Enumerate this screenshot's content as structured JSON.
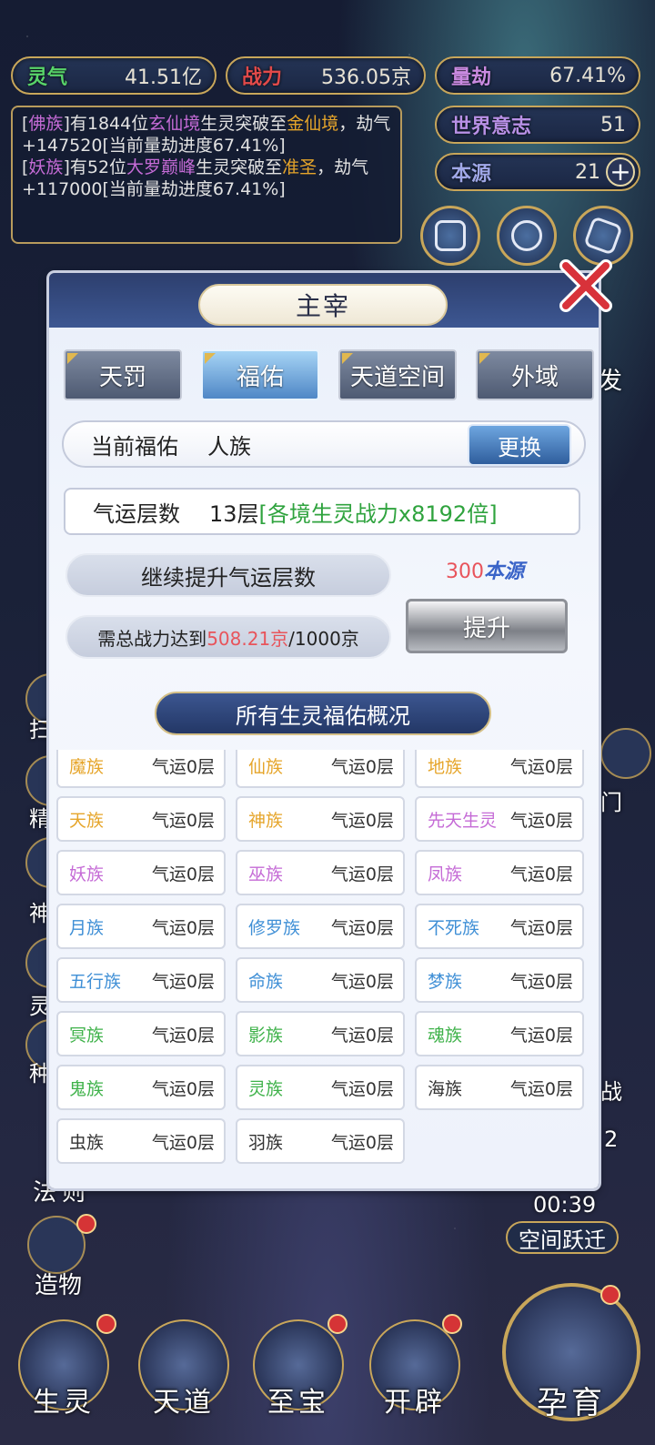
{
  "top_stats": {
    "lingqi": {
      "label": "灵气",
      "value": "41.51亿",
      "color": "#58d46a"
    },
    "zhanli": {
      "label": "战力",
      "value": "536.05京",
      "color": "#e14a4a"
    },
    "liangjie": {
      "label": "量劫",
      "value": "67.41%",
      "color": "#c98ae0"
    },
    "shijie": {
      "label": "世界意志",
      "value": "51",
      "color": "#b890e6"
    },
    "benyuan": {
      "label": "本源",
      "value": "21",
      "color": "#a0a8e8"
    }
  },
  "log": [
    {
      "bracket_open": "[",
      "race": "佛族",
      "race_color": "#c56bd6",
      "bracket_close": "]",
      "t1": "有1844位",
      "realm": "玄仙境",
      "realm_color": "#c56bd6",
      "t2": "生灵突破至",
      "target": "金仙境",
      "target_color": "#e6a52a",
      "t3": "，劫气+147520[当前量劫进度67.41%]"
    },
    {
      "bracket_open": "[",
      "race": "妖族",
      "race_color": "#c56bd6",
      "bracket_close": "]",
      "t1": "有52位",
      "realm": "大罗巅峰",
      "realm_color": "#c56bd6",
      "t2": "生灵突破至",
      "target": "准圣",
      "target_color": "#e6a52a",
      "t3": "，劫气+117000[当前量劫进度67.41%]"
    }
  ],
  "panel": {
    "title": "主宰",
    "tabs": [
      "天罚",
      "福佑",
      "天道空间",
      "外域",
      "发"
    ],
    "current_label": "当前福佑",
    "current_value": "人族",
    "swap_label": "更换",
    "luck_label": "气运层数",
    "luck_value": "13层",
    "luck_bonus": "[各境生灵战力x8192倍]",
    "continue_label": "继续提升气运层数",
    "req_prefix": "需总战力达到",
    "req_current": "508.21京",
    "req_target": "/1000京",
    "cost_num": "300",
    "cost_unit": "本源",
    "upgrade_label": "提升",
    "overview_label": "所有生灵福佑概况"
  },
  "races": [
    {
      "name": "魔族",
      "level": "气运0层",
      "color": "#e6a52a"
    },
    {
      "name": "仙族",
      "level": "气运0层",
      "color": "#e6a52a"
    },
    {
      "name": "地族",
      "level": "气运0层",
      "color": "#e6a52a"
    },
    {
      "name": "天族",
      "level": "气运0层",
      "color": "#e6a52a"
    },
    {
      "name": "神族",
      "level": "气运0层",
      "color": "#e6a52a"
    },
    {
      "name": "先天生灵",
      "level": "气运0层",
      "color": "#c56bd6"
    },
    {
      "name": "妖族",
      "level": "气运0层",
      "color": "#c56bd6"
    },
    {
      "name": "巫族",
      "level": "气运0层",
      "color": "#c56bd6"
    },
    {
      "name": "凤族",
      "level": "气运0层",
      "color": "#c56bd6"
    },
    {
      "name": "月族",
      "level": "气运0层",
      "color": "#3f8fd6"
    },
    {
      "name": "修罗族",
      "level": "气运0层",
      "color": "#3f8fd6"
    },
    {
      "name": "不死族",
      "level": "气运0层",
      "color": "#3f8fd6"
    },
    {
      "name": "五行族",
      "level": "气运0层",
      "color": "#3f8fd6"
    },
    {
      "name": "命族",
      "level": "气运0层",
      "color": "#3f8fd6"
    },
    {
      "name": "梦族",
      "level": "气运0层",
      "color": "#3f8fd6"
    },
    {
      "name": "冥族",
      "level": "气运0层",
      "color": "#3fb24a"
    },
    {
      "name": "影族",
      "level": "气运0层",
      "color": "#3fb24a"
    },
    {
      "name": "魂族",
      "level": "气运0层",
      "color": "#3fb24a"
    },
    {
      "name": "鬼族",
      "level": "气运0层",
      "color": "#3fb24a"
    },
    {
      "name": "灵族",
      "level": "气运0层",
      "color": "#3fb24a"
    },
    {
      "name": "海族",
      "level": "气运0层",
      "color": "#333333"
    },
    {
      "name": "虫族",
      "level": "气运0层",
      "color": "#333333"
    },
    {
      "name": "羽族",
      "level": "气运0层",
      "color": "#333333"
    }
  ],
  "side_labels": {
    "fa": "法",
    "ze": "则",
    "zaowu": "造物",
    "left_partials": [
      "扫",
      "精",
      "神",
      "灵",
      "种"
    ],
    "right_partials": [
      "门",
      "战"
    ],
    "count": "2"
  },
  "timer": "00:39",
  "space_jump": "空间跃迁",
  "bottom_nav": [
    "生灵",
    "天道",
    "至宝",
    "开辟",
    "孕育"
  ]
}
